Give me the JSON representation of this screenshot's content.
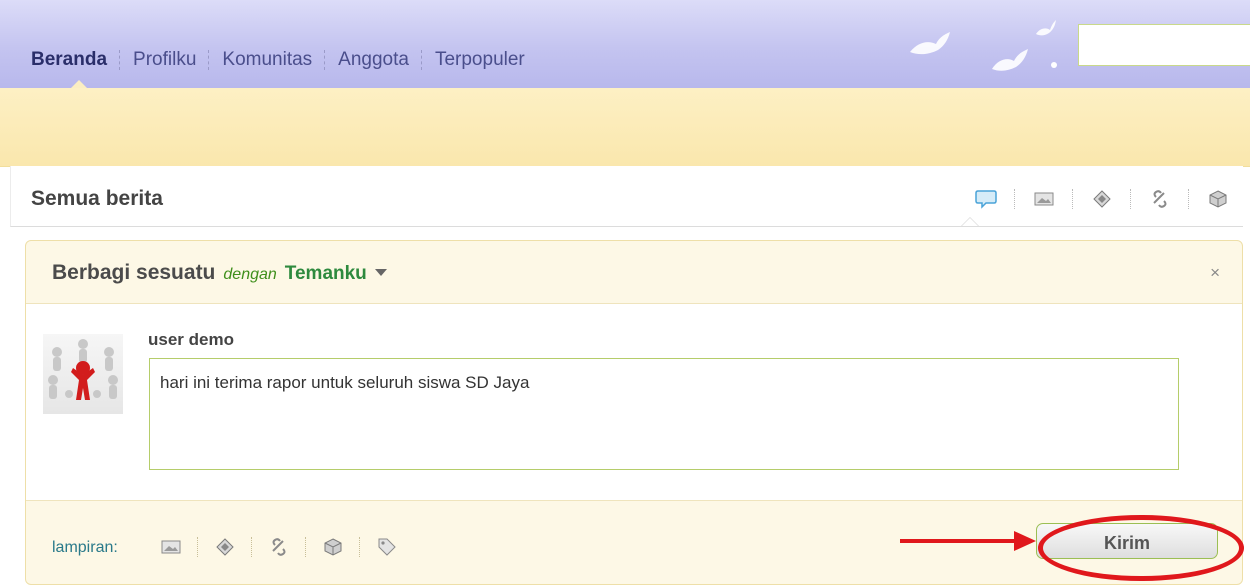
{
  "nav": {
    "items": [
      {
        "label": "Beranda",
        "active": true
      },
      {
        "label": "Profilku",
        "active": false
      },
      {
        "label": "Komunitas",
        "active": false
      },
      {
        "label": "Anggota",
        "active": false
      },
      {
        "label": "Terpopuler",
        "active": false
      }
    ],
    "search": {
      "placeholder": ""
    }
  },
  "news": {
    "title": "Semua berita",
    "filters": [
      {
        "icon": "speech-bubble-icon",
        "active": true
      },
      {
        "icon": "photo-icon",
        "active": false
      },
      {
        "icon": "video-icon",
        "active": false
      },
      {
        "icon": "link-icon",
        "active": false
      },
      {
        "icon": "box-icon",
        "active": false
      }
    ]
  },
  "share": {
    "title": "Berbagi sesuatu",
    "with": "dengan",
    "audience": "Temanku",
    "close": "×",
    "user": "user demo",
    "message": "hari ini terima rapor untuk seluruh siswa SD Jaya",
    "attach_label": "lampiran:",
    "attach_icons": [
      "photo-icon",
      "video-icon",
      "link-icon",
      "box-icon",
      "tag-icon"
    ],
    "submit": "Kirim"
  },
  "colors": {
    "nav_bg": "#c4c4f0",
    "yellow_band": "#fdf0c4",
    "accent_green": "#2e8a3e",
    "annotation_red": "#e0181c"
  }
}
